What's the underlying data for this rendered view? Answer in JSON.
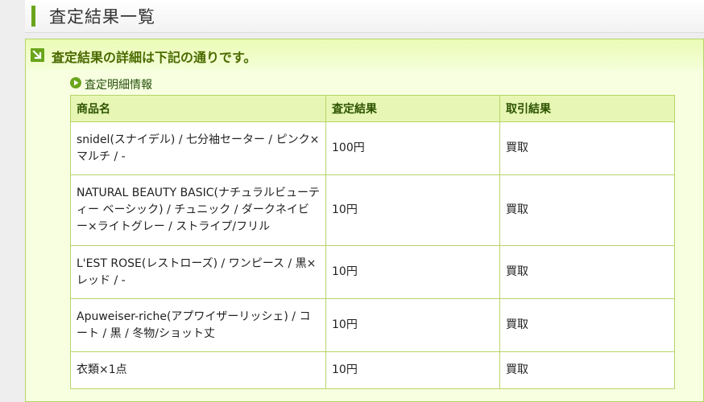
{
  "header": {
    "title": "査定結果一覧"
  },
  "panel": {
    "title": "査定結果の詳細は下記の通りです。",
    "section_label": "査定明細情報"
  },
  "table": {
    "columns": [
      "商品名",
      "査定結果",
      "取引結果"
    ],
    "rows": [
      {
        "name": "snidel(スナイデル) / 七分袖セーター / ピンク×マルチ / -",
        "price": "100円",
        "result": "買取"
      },
      {
        "name": "NATURAL BEAUTY BASIC(ナチュラルビューティー ベーシック) / チュニック / ダークネイビー×ライトグレー / ストライプ/フリル",
        "price": "10円",
        "result": "買取"
      },
      {
        "name": "L'EST ROSE(レストローズ) / ワンピース / 黒×レッド / -",
        "price": "10円",
        "result": "買取"
      },
      {
        "name": "Apuweiser-riche(アプワイザーリッシェ) / コート / 黒 / 冬物/ショット丈",
        "price": "10円",
        "result": "買取"
      },
      {
        "name": "衣類×1点",
        "price": "10円",
        "result": "買取"
      }
    ]
  },
  "colors": {
    "accent": "#6aa51c",
    "panel_bg": "#f7ffe0",
    "border": "#b7d46a"
  }
}
